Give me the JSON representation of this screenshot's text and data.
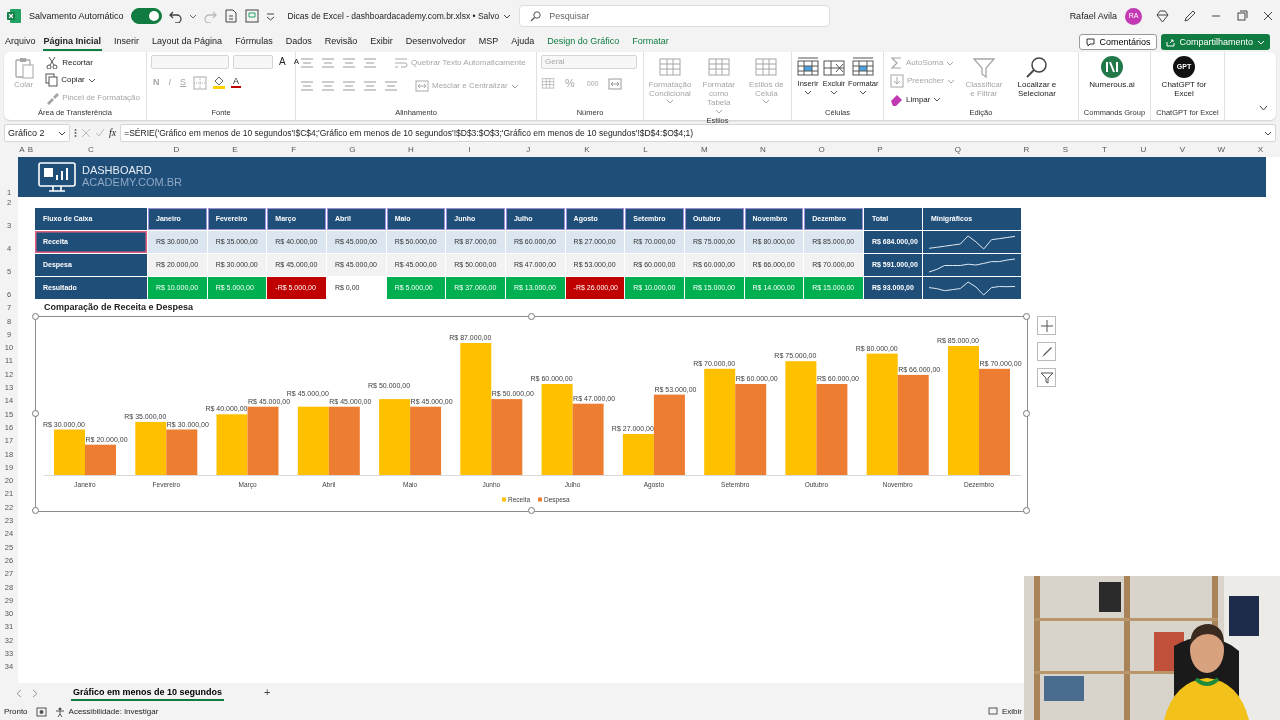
{
  "title_bar": {
    "autosave_label": "Salvamento Automático",
    "autosave_on": true,
    "file_title": "Dicas de Excel - dashboardacademy.com.br.xlsx • Salvo",
    "search": {
      "placeholder": "Pesquisar"
    },
    "user_name": "Rafael Avila",
    "avatar_initials": "RA"
  },
  "menu_tabs": [
    {
      "label": "Arquivo",
      "selected": false,
      "kind": "normal"
    },
    {
      "label": "Página Inicial",
      "selected": true,
      "kind": "normal"
    },
    {
      "label": "Inserir",
      "selected": false,
      "kind": "normal"
    },
    {
      "label": "Layout da Página",
      "selected": false,
      "kind": "normal"
    },
    {
      "label": "Fórmulas",
      "selected": false,
      "kind": "normal"
    },
    {
      "label": "Dados",
      "selected": false,
      "kind": "normal"
    },
    {
      "label": "Revisão",
      "selected": false,
      "kind": "normal"
    },
    {
      "label": "Exibir",
      "selected": false,
      "kind": "normal"
    },
    {
      "label": "Desenvolvedor",
      "selected": false,
      "kind": "normal"
    },
    {
      "label": "MSP",
      "selected": false,
      "kind": "normal"
    },
    {
      "label": "Ajuda",
      "selected": false,
      "kind": "normal"
    },
    {
      "label": "Design do Gráfico",
      "selected": false,
      "kind": "contextual"
    },
    {
      "label": "Formatar",
      "selected": false,
      "kind": "contextual"
    }
  ],
  "comments_button": "Comentários",
  "share_button": "Compartilhamento",
  "ribbon": [
    {
      "kind": "clipboard",
      "label": "Área de Transferência",
      "items": [
        {
          "label": "Colar",
          "disabled": true
        },
        {
          "label": "Recortar",
          "disabled": false
        },
        {
          "label": "Copiar",
          "disabled": false
        },
        {
          "label": "Pincel de Formatação",
          "disabled": true
        }
      ]
    },
    {
      "kind": "font",
      "label": "Fonte",
      "items": [
        {
          "label": "A",
          "disabled": false
        },
        {
          "label": "A",
          "disabled": false
        },
        {
          "label": "N",
          "disabled": true
        },
        {
          "label": "I",
          "disabled": true
        },
        {
          "label": "S",
          "disabled": true
        },
        {
          "label": "A",
          "disabled": false
        }
      ]
    },
    {
      "kind": "alignment",
      "label": "Alinhamento",
      "items": [
        {
          "label": "Quebrar Texto Automaticamente",
          "disabled": true
        },
        {
          "label": "Mesclar e Centralizar",
          "disabled": true
        }
      ]
    },
    {
      "kind": "number",
      "label": "Número",
      "format_field": {
        "value": "Geral",
        "disabled": true
      },
      "items": [
        {
          "label": "%",
          "disabled": true
        },
        {
          "label": "000",
          "disabled": true
        }
      ]
    },
    {
      "kind": "large_buttons",
      "label": "Estilos",
      "items": [
        {
          "label": "Formatação Condicional",
          "disabled": true
        },
        {
          "label": "Formatar como Tabela",
          "disabled": true
        },
        {
          "label": "Estilos de Célula",
          "disabled": true
        }
      ]
    },
    {
      "kind": "large_buttons",
      "label": "Células",
      "items": [
        {
          "label": "Inserir",
          "disabled": false
        },
        {
          "label": "Excluir",
          "disabled": false
        },
        {
          "label": "Formatar",
          "disabled": false
        }
      ]
    },
    {
      "kind": "editing",
      "label": "Edição",
      "items": [
        {
          "label": "AutoSoma",
          "disabled": true
        },
        {
          "label": "Preencher",
          "disabled": true
        },
        {
          "label": "Limpar",
          "disabled": false
        },
        {
          "label": "Classificar e Filtrar",
          "disabled": true
        },
        {
          "label": "Localizar e Selecionar",
          "disabled": false
        }
      ]
    },
    {
      "kind": "addin",
      "label": "Commands Group",
      "items": [
        {
          "label": "Numerous.ai",
          "disabled": false
        }
      ]
    },
    {
      "kind": "addin",
      "label": "ChatGPT for Excel",
      "items": [
        {
          "label": "ChatGPT for Excel",
          "disabled": false,
          "logo_text": "GPT"
        }
      ]
    }
  ],
  "formula_bar": {
    "name_box": "Gráfico 2",
    "function_label": "fx",
    "formula": "=SÉRIE('Gráfico em menos de 10 segundos'!$C$4;'Gráfico em menos de 10 segundos'!$D$3:$O$3;'Gráfico em menos de 10 segundos'!$D$4:$O$4;1)"
  },
  "column_headers": [
    "A",
    "B",
    "C",
    "D",
    "E",
    "F",
    "G",
    "H",
    "I",
    "J",
    "K",
    "L",
    "M",
    "N",
    "O",
    "P",
    "Q",
    "R",
    "S",
    "T",
    "U",
    "V",
    "W",
    "X"
  ],
  "row_headers": [
    "1",
    "2",
    "3",
    "4",
    "5",
    "6",
    "7",
    "8",
    "9",
    "10",
    "11",
    "12",
    "13",
    "14",
    "15",
    "16",
    "17",
    "18",
    "19",
    "20",
    "21",
    "22",
    "23",
    "24",
    "25",
    "26",
    "27",
    "28",
    "29",
    "30",
    "31",
    "32",
    "33",
    "34"
  ],
  "banner": {
    "logo_line_1": "DASHBOARD",
    "logo_line_2": "ACADEMY.COM.BR"
  },
  "cash_flow_table": {
    "header_label": "Fluxo de Caixa",
    "months_chart_range": true,
    "months": [
      "Janeiro",
      "Fevereiro",
      "Março",
      "Abril",
      "Maio",
      "Junho",
      "Julho",
      "Agosto",
      "Setembro",
      "Outubro",
      "Novembro",
      "Dezembro"
    ],
    "total_header": "Total",
    "sparkline_header": "Minigráficos",
    "rows": [
      {
        "label": "Receita",
        "kind": "plain",
        "chart_range": true,
        "cells": [
          {
            "text": "R$ 30.000,00"
          },
          {
            "text": "R$ 35.000,00"
          },
          {
            "text": "R$ 40.000,00"
          },
          {
            "text": "R$ 45.000,00"
          },
          {
            "text": "R$ 50.000,00"
          },
          {
            "text": "R$ 87.000,00"
          },
          {
            "text": "R$ 60.000,00"
          },
          {
            "text": "R$ 27.000,00"
          },
          {
            "text": "R$ 70.000,00"
          },
          {
            "text": "R$ 75.000,00"
          },
          {
            "text": "R$ 80.000,00"
          },
          {
            "text": "R$ 85.000,00"
          }
        ],
        "total": "R$ 684.000,00"
      },
      {
        "label": "Despesa",
        "kind": "plain",
        "chart_range": false,
        "cells": [
          {
            "text": "R$ 20.000,00"
          },
          {
            "text": "R$ 30.000,00"
          },
          {
            "text": "R$ 45.000,00"
          },
          {
            "text": "R$ 45.000,00"
          },
          {
            "text": "R$ 45.000,00"
          },
          {
            "text": "R$ 50.000,00"
          },
          {
            "text": "R$ 47.000,00"
          },
          {
            "text": "R$ 53.000,00"
          },
          {
            "text": "R$ 60.000,00"
          },
          {
            "text": "R$ 60.000,00"
          },
          {
            "text": "R$ 66.000,00"
          },
          {
            "text": "R$ 70.000,00"
          }
        ],
        "total": "R$ 591.000,00"
      },
      {
        "label": "Resultado",
        "kind": "colored",
        "chart_range": false,
        "cells": [
          {
            "text": "R$ 10.000,00",
            "color": "#00b050"
          },
          {
            "text": "R$ 5.000,00",
            "color": "#00b050"
          },
          {
            "text": "-R$ 5.000,00",
            "color": "#c00000"
          },
          {
            "text": "R$ 0,00",
            "color": "#ffffff"
          },
          {
            "text": "R$ 5.000,00",
            "color": "#00b050"
          },
          {
            "text": "R$ 37.000,00",
            "color": "#00b050"
          },
          {
            "text": "R$ 13.000,00",
            "color": "#00b050"
          },
          {
            "text": "-R$ 26.000,00",
            "color": "#c00000"
          },
          {
            "text": "R$ 10.000,00",
            "color": "#00b050"
          },
          {
            "text": "R$ 15.000,00",
            "color": "#00b050"
          },
          {
            "text": "R$ 14.000,00",
            "color": "#00b050"
          },
          {
            "text": "R$ 15.000,00",
            "color": "#00b050"
          }
        ],
        "total": "R$ 93.000,00"
      }
    ]
  },
  "chart": {
    "heading": "Comparação de Receita e Despesa",
    "chart_data": {
      "type": "bar",
      "categories": [
        "Janeiro",
        "Fevereiro",
        "Março",
        "Abril",
        "Maio",
        "Junho",
        "Julho",
        "Agosto",
        "Setembro",
        "Outubro",
        "Novembro",
        "Dezembro"
      ],
      "series": [
        {
          "name": "Receita",
          "color": "#ffc000",
          "values": [
            30000,
            35000,
            40000,
            45000,
            50000,
            87000,
            60000,
            27000,
            70000,
            75000,
            80000,
            85000
          ],
          "value_labels": [
            "R$ 30.000,00",
            "R$ 35.000,00",
            "R$ 40.000,00",
            "R$ 45.000,00",
            "R$ 50.000,00",
            "R$ 87.000,00",
            "R$ 60.000,00",
            "R$ 27.000,00",
            "R$ 70.000,00",
            "R$ 75.000,00",
            "R$ 80.000,00",
            "R$ 85.000,00"
          ]
        },
        {
          "name": "Despesa",
          "color": "#ed7d31",
          "values": [
            20000,
            30000,
            45000,
            45000,
            45000,
            50000,
            47000,
            53000,
            60000,
            60000,
            66000,
            70000
          ],
          "value_labels": [
            "R$ 20.000,00",
            "R$ 30.000,00",
            "R$ 45.000,00",
            "R$ 45.000,00",
            "R$ 45.000,00",
            "R$ 50.000,00",
            "R$ 47.000,00",
            "R$ 53.000,00",
            "R$ 60.000,00",
            "R$ 60.000,00",
            "R$ 66.000,00",
            "R$ 70.000,00"
          ]
        }
      ],
      "data_labels": true,
      "legend": true
    }
  },
  "sheet_tabs": [
    {
      "label": "Gráfico em menos de 10 segundos",
      "selected": true
    }
  ],
  "add_sheet": "+",
  "status_bar": {
    "mode": "Pronto",
    "accessibility": "Acessibilidade: investigar",
    "display_settings": "Exibir"
  }
}
